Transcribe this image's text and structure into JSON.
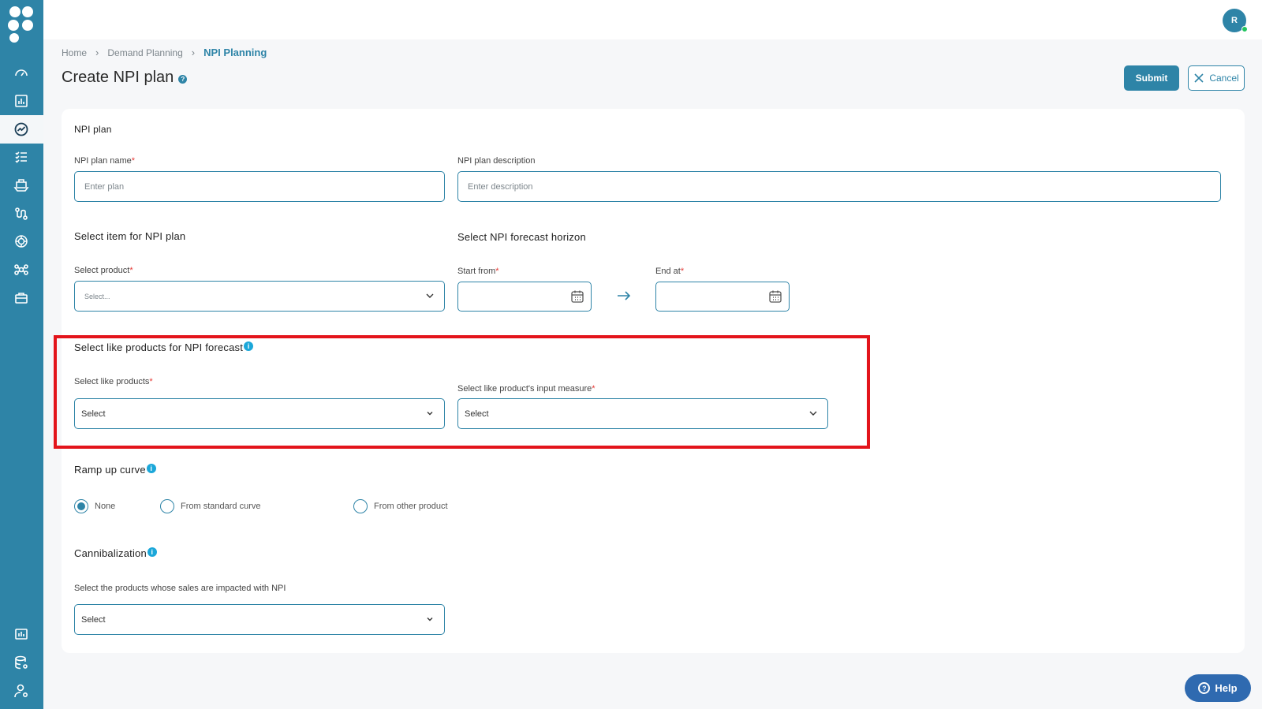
{
  "topbar": {
    "avatar_initial": "R"
  },
  "breadcrumb": {
    "items": [
      "Home",
      "Demand Planning"
    ],
    "current": "NPI Planning"
  },
  "page": {
    "title": "Create NPI plan",
    "help_glyph": "?"
  },
  "actions": {
    "submit": "Submit",
    "cancel": "Cancel"
  },
  "npi_plan": {
    "section_title": "NPI plan",
    "name_label": "NPI plan name",
    "name_placeholder": "Enter plan",
    "description_label": "NPI plan description",
    "description_placeholder": "Enter description"
  },
  "item_section": {
    "title": "Select item for NPI plan",
    "product_label": "Select product",
    "product_placeholder": "Select..."
  },
  "horizon_section": {
    "title": "Select NPI forecast horizon",
    "start_label": "Start from",
    "end_label": "End at"
  },
  "like_products": {
    "title": "Select like products for NPI forecast",
    "products_label": "Select like products",
    "products_value": "Select",
    "measure_label": "Select like product's input measure",
    "measure_value": "Select"
  },
  "ramp_up": {
    "title": "Ramp up curve",
    "options": [
      {
        "label": "None",
        "selected": true
      },
      {
        "label": "From standard curve",
        "selected": false
      },
      {
        "label": "From other product",
        "selected": false
      }
    ]
  },
  "cannibalization": {
    "title": "Cannibalization",
    "label": "Select the products whose sales are impacted with NPI",
    "value": "Select"
  },
  "help": {
    "label": "Help"
  },
  "required_mark": "*",
  "info_glyph": "i",
  "colors": {
    "brand": "#2e84a7",
    "highlight": "#e3141b",
    "required": "#e53935",
    "help": "#2f6ab0"
  },
  "sidebar_icons": [
    "dashboard-icon",
    "bar-chart-icon",
    "trend-icon",
    "checklist-icon",
    "ship-icon",
    "route-icon",
    "ai-icon",
    "network-icon",
    "briefcase-icon",
    "report-icon",
    "database-settings-icon",
    "user-settings-icon"
  ]
}
